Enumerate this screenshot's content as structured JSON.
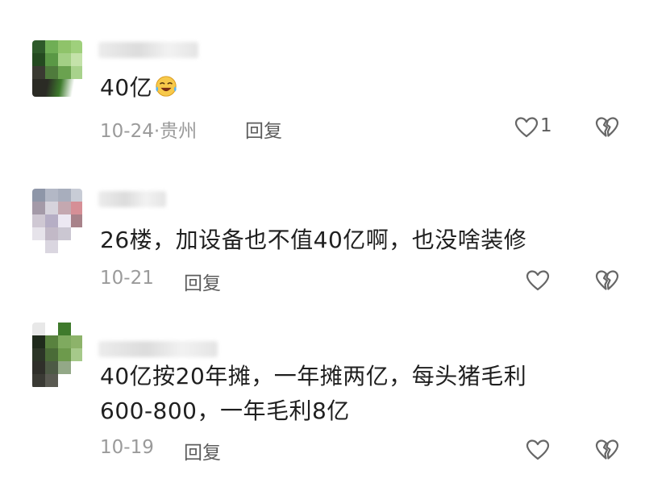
{
  "comments": [
    {
      "text": "40亿",
      "emoji": "tears-of-joy-emoji",
      "date": "10-24",
      "separator": "·",
      "location": "贵州",
      "reply_label": "回复",
      "like_count": "1"
    },
    {
      "text": "26楼，加设备也不值40亿啊，也没啥装修",
      "date": "10-21",
      "reply_label": "回复"
    },
    {
      "text_line1": "40亿按20年摊，一年摊两亿，每头猪毛利",
      "text_line2": "600-800，一年毛利8亿",
      "date": "10-19",
      "reply_label": "回复"
    }
  ],
  "icons": {
    "like": "heart-outline-icon",
    "dislike": "broken-heart-icon"
  },
  "colors": {
    "text": "#1f1f1f",
    "meta": "#9a9a9a",
    "reply": "#5c5c5c",
    "icon": "#666666"
  }
}
